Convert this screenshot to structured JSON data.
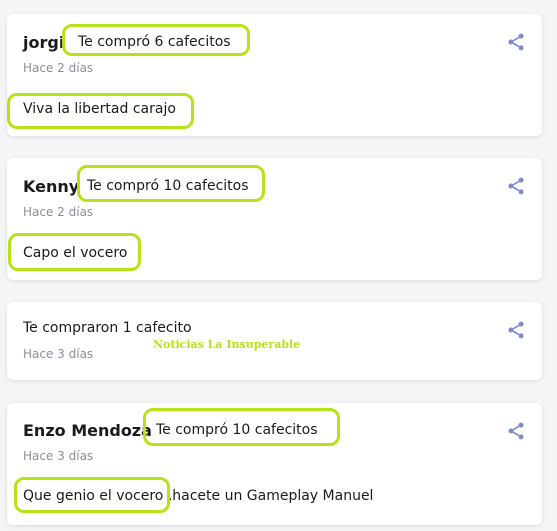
{
  "cards": [
    {
      "name": "jorgi",
      "action": "Te compró 6 cafecitos",
      "time": "Hace 2 días",
      "message": "Viva la libertad carajo"
    },
    {
      "name": "Kenny",
      "action": "Te compró 10 cafecitos",
      "time": "Hace 2 días",
      "message": "Capo el vocero"
    },
    {
      "name": "",
      "action": "Te compraron 1 cafecito",
      "time": "Hace 3 días",
      "message": ""
    },
    {
      "name": "Enzo Mendoza",
      "action": "Te compró 10 cafecitos",
      "time": "Hace 3 días",
      "message": "Que genio el vocero ,hacete un Gameplay Manuel"
    }
  ],
  "watermark": "Noticias La Insuperable",
  "colors": {
    "highlight": "#b6e21a",
    "share_icon": "#7b8cc6",
    "background": "#f4f5f7"
  },
  "icons": {
    "share": "share-icon"
  }
}
